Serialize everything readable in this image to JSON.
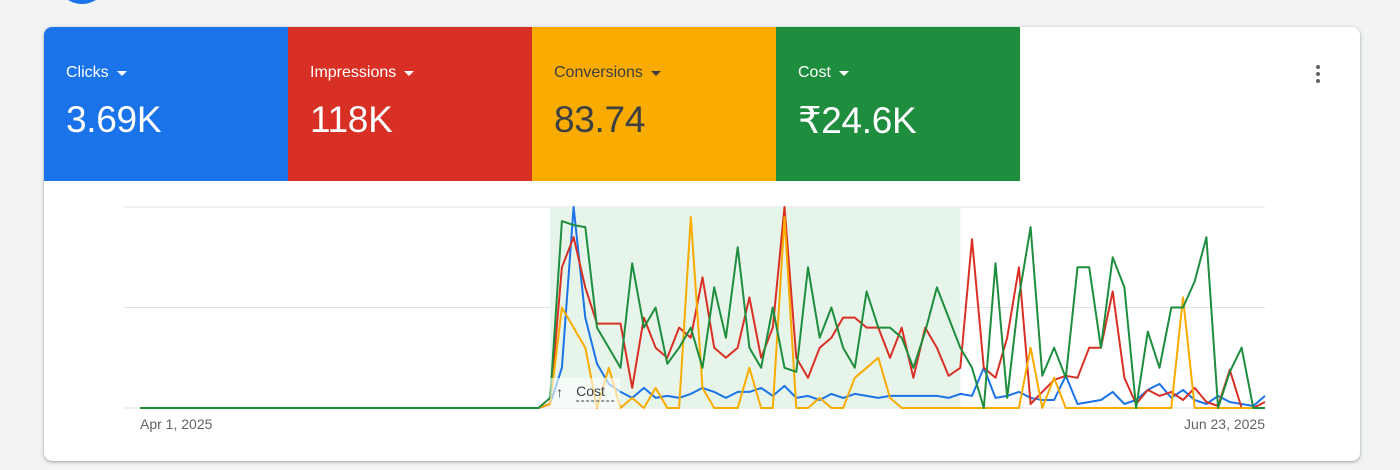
{
  "metrics": [
    {
      "id": "clicks",
      "label": "Clicks",
      "value": "3.69K",
      "color": "#1a73e8"
    },
    {
      "id": "impressions",
      "label": "Impressions",
      "value": "118K",
      "color": "#d93025"
    },
    {
      "id": "conversions",
      "label": "Conversions",
      "value": "83.74",
      "color": "#f9ab00"
    },
    {
      "id": "cost",
      "label": "Cost",
      "value": "₹24.6K",
      "color": "#1e8e3e"
    }
  ],
  "menu": {
    "icon": "more-vert-icon"
  },
  "chart_data": {
    "type": "line",
    "x_start_label": "Apr 1, 2025",
    "x_end_label": "Jun 23, 2025",
    "annotation": "Cost",
    "annotation_icon": "arrow-up-icon",
    "days": 84,
    "ylim": [
      0,
      100
    ],
    "grid": true,
    "highlight": {
      "start_index": 35,
      "end_index": 70,
      "color": "#e6f4ea"
    },
    "series": [
      {
        "name": "Clicks",
        "color": "#1a73e8",
        "values": [
          0,
          0,
          0,
          0,
          0,
          0,
          0,
          0,
          0,
          0,
          0,
          0,
          0,
          0,
          0,
          0,
          0,
          0,
          0,
          0,
          0,
          0,
          0,
          0,
          0,
          0,
          0,
          0,
          0,
          0,
          0,
          0,
          0,
          0,
          0,
          2,
          20,
          100,
          45,
          22,
          12,
          8,
          5,
          10,
          5,
          6,
          5,
          7,
          10,
          8,
          5,
          8,
          8,
          10,
          6,
          11,
          5,
          6,
          4,
          7,
          5,
          7,
          6,
          5,
          6,
          6,
          6,
          6,
          6,
          5,
          7,
          6,
          20,
          5,
          6,
          8,
          5,
          4,
          4,
          16,
          2,
          3,
          4,
          8,
          2,
          4,
          9,
          12,
          5,
          9,
          4,
          2,
          6,
          3,
          2,
          1,
          6
        ]
      },
      {
        "name": "Impressions",
        "color": "#d93025",
        "values": [
          0,
          0,
          0,
          0,
          0,
          0,
          0,
          0,
          0,
          0,
          0,
          0,
          0,
          0,
          0,
          0,
          0,
          0,
          0,
          0,
          0,
          0,
          0,
          0,
          0,
          0,
          0,
          0,
          0,
          0,
          0,
          0,
          0,
          0,
          0,
          2,
          70,
          85,
          60,
          42,
          42,
          42,
          10,
          45,
          30,
          25,
          40,
          35,
          65,
          30,
          25,
          30,
          55,
          25,
          40,
          100,
          25,
          15,
          30,
          35,
          45,
          45,
          40,
          40,
          25,
          40,
          15,
          40,
          30,
          16,
          20,
          84,
          20,
          15,
          35,
          70,
          2,
          8,
          14,
          16,
          15,
          30,
          30,
          58,
          15,
          2,
          9,
          6,
          8,
          4,
          10,
          3,
          1,
          19,
          0,
          0,
          3
        ]
      },
      {
        "name": "Conversions",
        "color": "#f9ab00",
        "values": [
          0,
          0,
          0,
          0,
          0,
          0,
          0,
          0,
          0,
          0,
          0,
          0,
          0,
          0,
          0,
          0,
          0,
          0,
          0,
          0,
          0,
          0,
          0,
          0,
          0,
          0,
          0,
          0,
          0,
          0,
          0,
          0,
          0,
          0,
          0,
          2,
          50,
          40,
          30,
          0,
          20,
          0,
          5,
          0,
          10,
          0,
          0,
          95,
          10,
          0,
          0,
          0,
          20,
          0,
          0,
          95,
          0,
          0,
          5,
          0,
          0,
          15,
          20,
          25,
          5,
          0,
          0,
          0,
          0,
          0,
          0,
          0,
          0,
          0,
          0,
          0,
          30,
          0,
          15,
          0,
          0,
          0,
          0,
          0,
          0,
          0,
          0,
          0,
          0,
          55,
          0,
          0,
          0,
          0,
          0,
          0,
          0
        ]
      },
      {
        "name": "Cost",
        "color": "#1e8e3e",
        "values": [
          0,
          0,
          0,
          0,
          0,
          0,
          0,
          0,
          0,
          0,
          0,
          0,
          0,
          0,
          0,
          0,
          0,
          0,
          0,
          0,
          0,
          0,
          0,
          0,
          0,
          0,
          0,
          0,
          0,
          0,
          0,
          0,
          0,
          0,
          0,
          5,
          93,
          91,
          90,
          40,
          30,
          20,
          72,
          40,
          50,
          22,
          30,
          40,
          20,
          60,
          35,
          80,
          30,
          20,
          50,
          20,
          18,
          70,
          35,
          50,
          30,
          20,
          58,
          40,
          40,
          35,
          20,
          38,
          60,
          45,
          30,
          20,
          0,
          72,
          5,
          55,
          90,
          16,
          30,
          15,
          70,
          70,
          30,
          75,
          60,
          0,
          38,
          20,
          50,
          50,
          63,
          85,
          0,
          18,
          30,
          0,
          0
        ]
      }
    ]
  }
}
